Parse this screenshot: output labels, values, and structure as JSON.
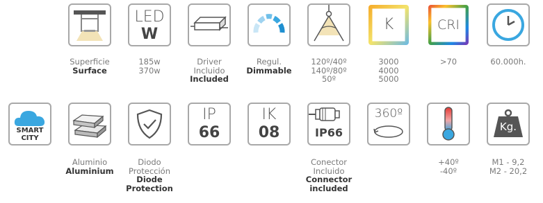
{
  "row1": [
    {
      "id": "surface",
      "icon": "surface-mount-icon",
      "lines": [
        "Superficie"
      ],
      "bold": [
        "Surface"
      ]
    },
    {
      "id": "power",
      "icon": "led-power-icon",
      "tile_top": "LED",
      "tile_bottom": "W",
      "lines": [
        "185w",
        "370w"
      ],
      "bold": []
    },
    {
      "id": "driver",
      "icon": "driver-icon",
      "lines": [
        "Driver",
        "Incluido"
      ],
      "bold": [
        "Included"
      ]
    },
    {
      "id": "dimmable",
      "icon": "dimmer-icon",
      "lines": [
        "Regul."
      ],
      "bold": [
        "Dimmable"
      ]
    },
    {
      "id": "beam",
      "icon": "beam-angle-icon",
      "lines": [
        "120º/40º",
        "140º/80º",
        "50º"
      ],
      "bold": []
    },
    {
      "id": "cct",
      "icon": "color-temperature-icon",
      "tile_text": "K",
      "lines": [
        "3000",
        "4000",
        "5000"
      ],
      "bold": []
    },
    {
      "id": "cri",
      "icon": "cri-icon",
      "tile_text": "CRI",
      "lines": [
        ">70"
      ],
      "bold": []
    },
    {
      "id": "lifetime",
      "icon": "clock-icon",
      "lines": [
        "60.000h."
      ],
      "bold": []
    }
  ],
  "row2": [
    {
      "id": "smartcity",
      "icon": "cloud-icon",
      "tile_text": [
        "SMART",
        "CITY"
      ],
      "lines": [],
      "bold": []
    },
    {
      "id": "material",
      "icon": "aluminium-ingots-icon",
      "lines": [
        "Aluminio"
      ],
      "bold": [
        "Aluminium"
      ]
    },
    {
      "id": "protection",
      "icon": "shield-check-icon",
      "lines": [
        "Diodo",
        "Protección"
      ],
      "bold": [
        "Diode",
        "Protection"
      ]
    },
    {
      "id": "ip",
      "icon": "ip-rating-icon",
      "tile_top": "IP",
      "tile_bottom": "66",
      "lines": [],
      "bold": []
    },
    {
      "id": "ik",
      "icon": "ik-rating-icon",
      "tile_top": "IK",
      "tile_bottom": "08",
      "lines": [],
      "bold": []
    },
    {
      "id": "connector",
      "icon": "connector-icon",
      "tile_text": "IP66",
      "lines": [
        "Conector",
        "Incluido"
      ],
      "bold": [
        "Connector",
        "included"
      ]
    },
    {
      "id": "rotation",
      "icon": "rotation-360-icon",
      "tile_text": "360º",
      "lines": [],
      "bold": []
    },
    {
      "id": "temperature",
      "icon": "thermometer-icon",
      "lines": [
        "+40º",
        "-40º"
      ],
      "bold": []
    },
    {
      "id": "weight",
      "icon": "weight-icon",
      "tile_text": "Kg.",
      "lines": [
        "M1 - 9,2",
        "M2 - 20,2"
      ],
      "bold": []
    }
  ],
  "colors": {
    "border": "#a8a8a8",
    "accent": "#3aa7e0",
    "text": "#7a7a7a",
    "bold": "#333333"
  }
}
